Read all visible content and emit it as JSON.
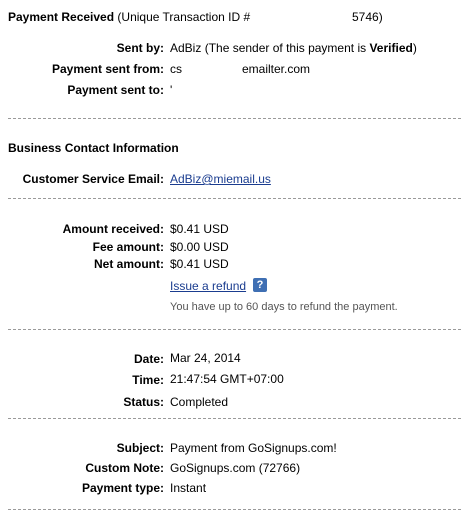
{
  "header": {
    "title": "Payment Received",
    "txid_prefix": "(Unique Transaction ID #",
    "txid_suffix": "5746)"
  },
  "payment_info": {
    "sent_by_label": "Sent by:",
    "sent_by_name": "AdBiz",
    "sent_by_note_prefix": "(The sender of this payment is",
    "sent_by_verified": "Verified",
    "sent_by_note_suffix": ")",
    "sent_from_label": "Payment sent from:",
    "sent_from_value": "cs",
    "sent_from_value_tail": "emailter.com",
    "sent_to_label": "Payment sent to:",
    "sent_to_value": "'"
  },
  "business_contact": {
    "heading": "Business Contact Information",
    "email_label": "Customer Service Email:",
    "email_value": "AdBiz@miemail.us"
  },
  "amounts": {
    "received_label": "Amount received:",
    "received_value": "$0.41 USD",
    "fee_label": "Fee amount:",
    "fee_value": "$0.00 USD",
    "net_label": "Net amount:",
    "net_value": "$0.41 USD",
    "refund_link": "Issue a refund",
    "help_icon": "?",
    "refund_note": "You have up to 60 days to refund the payment."
  },
  "status_info": {
    "date_label": "Date:",
    "date_value": "Mar 24, 2014",
    "time_label": "Time:",
    "time_value": "21:47:54 GMT+07:00",
    "status_label": "Status:",
    "status_value": "Completed"
  },
  "details": {
    "subject_label": "Subject:",
    "subject_value": "Payment from GoSignups.com!",
    "note_label": "Custom Note:",
    "note_value": "GoSignups.com (72766)",
    "type_label": "Payment type:",
    "type_value": "Instant"
  }
}
